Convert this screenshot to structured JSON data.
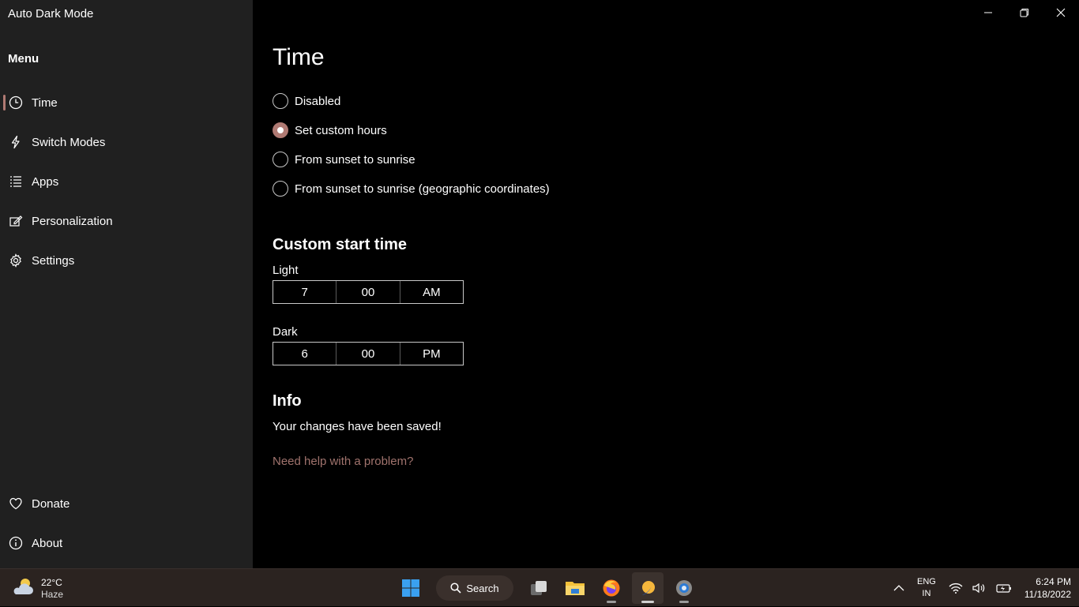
{
  "window": {
    "title": "Auto Dark Mode"
  },
  "sidebar": {
    "menu_label": "Menu",
    "items": [
      {
        "label": "Time",
        "icon": "clock-icon",
        "active": true
      },
      {
        "label": "Switch Modes",
        "icon": "lightning-icon"
      },
      {
        "label": "Apps",
        "icon": "list-icon"
      },
      {
        "label": "Personalization",
        "icon": "paint-icon"
      },
      {
        "label": "Settings",
        "icon": "gear-icon"
      }
    ],
    "footer_items": [
      {
        "label": "Donate",
        "icon": "heart-icon"
      },
      {
        "label": "About",
        "icon": "info-icon"
      }
    ]
  },
  "main": {
    "title": "Time",
    "options": [
      {
        "label": "Disabled",
        "checked": false
      },
      {
        "label": "Set custom hours",
        "checked": true
      },
      {
        "label": "From sunset to sunrise",
        "checked": false
      },
      {
        "label": "From sunset to sunrise (geographic coordinates)",
        "checked": false
      }
    ],
    "custom_start": {
      "title": "Custom start time",
      "light": {
        "label": "Light",
        "hour": "7",
        "minute": "00",
        "period": "AM"
      },
      "dark": {
        "label": "Dark",
        "hour": "6",
        "minute": "00",
        "period": "PM"
      }
    },
    "info": {
      "title": "Info",
      "message": "Your changes have been saved!",
      "help_link": "Need help with a problem?"
    }
  },
  "taskbar": {
    "weather": {
      "temp": "22°C",
      "condition": "Haze"
    },
    "search_label": "Search",
    "lang": {
      "line1": "ENG",
      "line2": "IN"
    },
    "clock": {
      "time": "6:24 PM",
      "date": "11/18/2022"
    }
  },
  "colors": {
    "accent": "#b07a73",
    "sidebar_bg": "#202020",
    "taskbar_bg": "#2b2320"
  }
}
